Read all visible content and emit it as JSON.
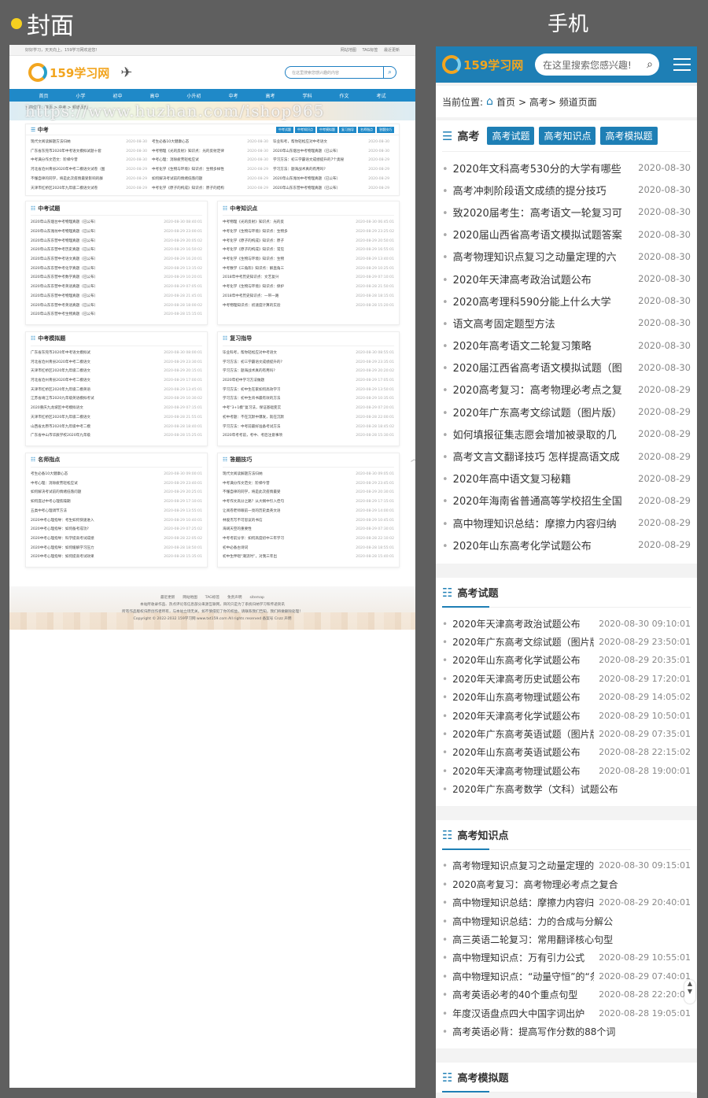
{
  "labels": {
    "cover": "封面",
    "phone": "手机"
  },
  "desktop": {
    "topbar_left": "好好学习，天天向上。159学习网欢迎您!",
    "topbar_links": [
      "网站地图",
      "TAG标签",
      "最近更新"
    ],
    "logo_text": "159学习网",
    "search_placeholder": "在这里搜索您感兴趣的内容",
    "nav": [
      "首页",
      "小学",
      "初中",
      "高中",
      "小升初",
      "中考",
      "高考",
      "学科",
      "作文",
      "考试"
    ],
    "watermark": "https://www.huzhan.com/ishop965",
    "breadcrumb": "当前位置：首页 > 中考 > 频道页面",
    "main_block": {
      "title": "中考",
      "tabs": [
        "中考试题",
        "中考知识点",
        "中考模拟题",
        "复习指导",
        "名师指点",
        "答题技巧"
      ],
      "col1": [
        {
          "t": "现代文阅读解题方法归纳",
          "d": "2020-08-30"
        },
        {
          "t": "广东省东莞市2020年中考语文模拟试题十套",
          "d": "2020-08-30"
        },
        {
          "t": "中考满分作文范文：阶梯今昔",
          "d": "2020-08-30"
        },
        {
          "t": "河北省沧州青县2020年中考二模语文试卷（图",
          "d": "2020-08-29"
        },
        {
          "t": "不懂自律的同学，将是此次疫情最受影响的群",
          "d": "2020-08-29"
        },
        {
          "t": "天津市红桥区2020年九年级二模语文试卷",
          "d": "2020-08-29"
        }
      ],
      "col2": [
        {
          "t": "考生必备10大健康心态",
          "d": "2020-08-30"
        },
        {
          "t": "中考物理《光的反射》知识点：光的反射定律",
          "d": "2020-08-30"
        },
        {
          "t": "中考心理：消除疲劳轻松应试",
          "d": "2020-08-30"
        },
        {
          "t": "中考化学《生物与环境》知识点：生物多样性",
          "d": "2020-08-29"
        },
        {
          "t": "如何解决考试前的情绪低落问题",
          "d": "2020-08-29"
        },
        {
          "t": "中考化学《原子的构成》知识点：原子的结构",
          "d": "2020-08-29"
        }
      ],
      "col3": [
        {
          "t": "毕业科考，帮你轻松应对中考语文",
          "d": "2020-08-30"
        },
        {
          "t": "2020年山东烟台中考物理真题（已公布）",
          "d": "2020-08-30"
        },
        {
          "t": "学习方法：初三学霸语文成绩提升的7个奥秘",
          "d": "2020-08-29"
        },
        {
          "t": "学习方法：题海战术真的有用吗?",
          "d": "2020-08-29"
        },
        {
          "t": "2020年山东潍坊中考物理真题（已公布）",
          "d": "2020-08-29"
        },
        {
          "t": "2020年山东东营中考物理真题（已公布）",
          "d": "2020-08-29"
        }
      ]
    },
    "cards": [
      {
        "title": "中考试题",
        "items": [
          {
            "t": "2020年山东烟台中考物理真题（已公布）",
            "d": "2020-08-30 08:40:01"
          },
          {
            "t": "2020年山东潍坊中考物理真题（已公布）",
            "d": "2020-08-29 23:00:01"
          },
          {
            "t": "2020年山东东营中考物理真题（已公布）",
            "d": "2020-08-29 20:05:02"
          },
          {
            "t": "2020年山东东营中考历史真题（已公布）",
            "d": "2020-08-29 16:50:02"
          },
          {
            "t": "2020年山东东营中考语文真题（已公布）",
            "d": "2020-08-29 16:20:01"
          },
          {
            "t": "2020年山东东营中考化学真题（已公布）",
            "d": "2020-08-29 13:15:02"
          },
          {
            "t": "2020年山东东营中考数学真题（已公布）",
            "d": "2020-08-29 10:20:01"
          },
          {
            "t": "2020年山东东营中考英语真题（已公布）",
            "d": "2020-08-29 07:05:01"
          },
          {
            "t": "2020年山东东营中考物理真题（已公布）",
            "d": "2020-08-28 21:45:01"
          },
          {
            "t": "2020年山东东营中考英语真题（已公布）",
            "d": "2020-08-28 18:00:02"
          },
          {
            "t": "2020年山东东营中考生物真题（已公布）",
            "d": "2020-08-28 15:15:01"
          }
        ]
      },
      {
        "title": "中考知识点",
        "items": [
          {
            "t": "中考物理《光的反射》知识点：光的反",
            "d": "2020-08-30 06:45:01"
          },
          {
            "t": "中考化学《生物与环境》知识点：生物多",
            "d": "2020-08-29 23:25:02"
          },
          {
            "t": "中考化学《原子的构成》知识点：原子",
            "d": "2020-08-29 20:50:01"
          },
          {
            "t": "中考化学《原子的构成》知识点：常见",
            "d": "2020-08-29 16:55:01"
          },
          {
            "t": "中考化学《生物与环境》知识点：生物",
            "d": "2020-08-29 13:40:01"
          },
          {
            "t": "中考数学《三角形》知识点：解直角三",
            "d": "2020-08-29 10:25:01"
          },
          {
            "t": "2018年中考历史知识点：文艺复兴",
            "d": "2020-08-29 07:10:01"
          },
          {
            "t": "中考化学《生物与环境》知识点：保护",
            "d": "2020-08-28 21:50:01"
          },
          {
            "t": "2018年中考历史知识点：一带一路",
            "d": "2020-08-28 18:15:01"
          },
          {
            "t": "中考物理知识点：初速度计算的实验",
            "d": "2020-08-28 15:20:01"
          }
        ]
      },
      {
        "title": "中考模拟题",
        "items": [
          {
            "t": "广东省东莞市2020年中考语文模拟试",
            "d": "2020-08-30 08:00:01"
          },
          {
            "t": "河北省沧州青县2020年中考二模语文",
            "d": "2020-08-29 23:30:01"
          },
          {
            "t": "天津市红桥区2020年九年级二模语文",
            "d": "2020-08-29 20:15:01"
          },
          {
            "t": "河北省沧州青县2020年中考二模语文",
            "d": "2020-08-29 17:00:01"
          },
          {
            "t": "天津市红桥区2020年九年级二模英语",
            "d": "2020-08-29 13:45:01"
          },
          {
            "t": "江苏省靖江市2020九年级英语模拟考试",
            "d": "2020-08-29 10:30:02"
          },
          {
            "t": "2020重庆九龙坡区中考模拟语文",
            "d": "2020-08-29 07:15:01"
          },
          {
            "t": "天津市红桥区2020年九年级二模语文",
            "d": "2020-08-28 21:55:01"
          },
          {
            "t": "山西省太原市2020年九年级中考二模",
            "d": "2020-08-28 18:40:01"
          },
          {
            "t": "广东省中山市华辰学校2020年九年级",
            "d": "2020-08-28 15:25:01"
          }
        ]
      },
      {
        "title": "复习指导",
        "items": [
          {
            "t": "毕业科考，帮你轻松应对中考语文",
            "d": "2020-08-30 08:55:01"
          },
          {
            "t": "学习方法：初三学霸语文成绩提升的?",
            "d": "2020-08-29 23:35:01"
          },
          {
            "t": "学习方法：题海战术真的有用吗?",
            "d": "2020-08-29 20:20:02"
          },
          {
            "t": "2020年初中学习方法做题",
            "d": "2020-08-29 17:05:01"
          },
          {
            "t": "学习方法：初中生在家如何高效学习",
            "d": "2020-08-29 13:50:01"
          },
          {
            "t": "学习方法：初中生背书最有效的方法",
            "d": "2020-08-29 10:35:01"
          },
          {
            "t": "中考“3+1模”复习法，保证基础变实",
            "d": "2020-08-29 07:20:01"
          },
          {
            "t": "初中考题：不在沉默中爆发，就在沉默",
            "d": "2020-08-28 22:00:01"
          },
          {
            "t": "学习方法：中考前最好准备考试方法",
            "d": "2020-08-28 18:45:02"
          },
          {
            "t": "2020年考考前，考中、考后注意事项",
            "d": "2020-08-28 15:30:01"
          }
        ]
      },
      {
        "title": "名师指点",
        "items": [
          {
            "t": "考生必备10大健康心态",
            "d": "2020-08-30 09:00:01"
          },
          {
            "t": "中考心理：消除疲劳轻松应试",
            "d": "2020-08-29 23:40:01"
          },
          {
            "t": "如何解决考试前的情绪低落问题",
            "d": "2020-08-29 20:25:01"
          },
          {
            "t": "如何度过中考心理焦躁期",
            "d": "2020-08-29 17:10:01"
          },
          {
            "t": "五类中考心理调节方法",
            "d": "2020-08-29 13:55:01"
          },
          {
            "t": "2020中考心理指导：考生如何快速进入",
            "d": "2020-08-29 10:40:01"
          },
          {
            "t": "2020中考心理指导：如何备考成功?",
            "d": "2020-08-29 07:25:02"
          },
          {
            "t": "2020中考心理指导：科学提高考试成绩",
            "d": "2020-08-28 22:05:02"
          },
          {
            "t": "2020中考心理指导：如何缓解学习压力",
            "d": "2020-08-28 18:50:01"
          },
          {
            "t": "2020中考心理指导：如何提高考试效果",
            "d": "2020-08-28 15:35:01"
          }
        ]
      },
      {
        "title": "答题技巧",
        "items": [
          {
            "t": "现代文阅读解题方法归纳",
            "d": "2020-08-30 09:05:01"
          },
          {
            "t": "中考满分作文范文：阶梯今昔",
            "d": "2020-08-29 23:45:01"
          },
          {
            "t": "不懂自律的同学，将是此次疫情最受",
            "d": "2020-08-29 20:30:01"
          },
          {
            "t": "中考作文高分之路？从大纲中引入佳句",
            "d": "2020-08-29 17:15:01"
          },
          {
            "t": "让阅卷老师眼前一亮的历史类英文语",
            "d": "2020-08-29 14:00:01"
          },
          {
            "t": "林俊杰写不可思议的书信",
            "d": "2020-08-29 10:45:01"
          },
          {
            "t": "海阔天空的重要性",
            "d": "2020-08-29 07:30:01"
          },
          {
            "t": "中考考前分享：如何高度初中三年学习",
            "d": "2020-08-28 22:10:02"
          },
          {
            "t": "初中必备古诗词",
            "d": "2020-08-28 18:55:01"
          },
          {
            "t": "初中生伴唱“潮流时”，对我三年出",
            "d": "2020-08-28 15:40:01"
          }
        ]
      }
    ],
    "footer_links": [
      "最近更新",
      "网站地图",
      "TAG标签",
      "免责声明",
      "sitemap"
    ],
    "footer_lines": [
      "本站所收录作品、热点评论等信息部分来源互联网，目的只是为了系统归纳学习和传递资讯",
      "所有作品版权归原创作者所有，与本站立场无关，如不慎侵犯了你的权益，请联系我们告知，我们将做删除处理！",
      "Copyright © 2022-2032 159学习网 www.txt159.com All rights reserved 备案号 Cnzz 声明"
    ]
  },
  "mobile": {
    "logo_text": "159学习网",
    "search_placeholder": "在这里搜索您感兴趣!",
    "breadcrumb_prefix": "当前位置:",
    "breadcrumb_home": "首页",
    "breadcrumb_rest": "> 高考> 频道页面",
    "main_title": "高考",
    "tabs": [
      "高考试题",
      "高考知识点",
      "高考模拟题"
    ],
    "main_items": [
      {
        "t": "2020年文科高考530分的大学有哪些",
        "d": "2020-08-30"
      },
      {
        "t": "高考冲刺阶段语文成绩的提分技巧",
        "d": "2020-08-30"
      },
      {
        "t": "致2020届考生：高考语文一轮复习可",
        "d": "2020-08-30"
      },
      {
        "t": "2020届山西省高考语文模拟试题答案",
        "d": "2020-08-30"
      },
      {
        "t": "高考物理知识点复习之动量定理的六",
        "d": "2020-08-30"
      },
      {
        "t": "2020年天津高考政治试题公布",
        "d": "2020-08-30"
      },
      {
        "t": "2020高考理科590分能上什么大学",
        "d": "2020-08-30"
      },
      {
        "t": "语文高考固定题型方法",
        "d": "2020-08-30"
      },
      {
        "t": "2020年高考语文二轮复习策略",
        "d": "2020-08-30"
      },
      {
        "t": "2020届江西省高考语文模拟试题（图",
        "d": "2020-08-30"
      },
      {
        "t": "2020高考复习：高考物理必考点之复",
        "d": "2020-08-29"
      },
      {
        "t": "2020年广东高考文综试题（图片版）",
        "d": "2020-08-29"
      },
      {
        "t": "如何填报征集志愿会增加被录取的几",
        "d": "2020-08-29"
      },
      {
        "t": "高考文言文翻译技巧 怎样提高语文成",
        "d": "2020-08-29"
      },
      {
        "t": "2020年高中语文复习秘籍",
        "d": "2020-08-29"
      },
      {
        "t": "2020年海南省普通高等学校招生全国",
        "d": "2020-08-29"
      },
      {
        "t": "高中物理知识总结：摩擦力内容归纳",
        "d": "2020-08-29"
      },
      {
        "t": "2020年山东高考化学试题公布",
        "d": "2020-08-29"
      }
    ],
    "sections": [
      {
        "title": "高考试题",
        "items": [
          {
            "t": "2020年天津高考政治试题公布",
            "d": "2020-08-30 09:10:01"
          },
          {
            "t": "2020年广东高考文综试题（图片版）",
            "d": "2020-08-29 23:50:01"
          },
          {
            "t": "2020年山东高考化学试题公布",
            "d": "2020-08-29 20:35:01"
          },
          {
            "t": "2020年天津高考历史试题公布",
            "d": "2020-08-29 17:20:01"
          },
          {
            "t": "2020年山东高考物理试题公布",
            "d": "2020-08-29 14:05:02"
          },
          {
            "t": "2020年天津高考化学试题公布",
            "d": "2020-08-29 10:50:01"
          },
          {
            "t": "2020年广东高考英语试题（图片版）",
            "d": "2020-08-29 07:35:01"
          },
          {
            "t": "2020年山东高考英语试题公布",
            "d": "2020-08-28 22:15:02"
          },
          {
            "t": "2020年天津高考物理试题公布",
            "d": "2020-08-28 19:00:01"
          },
          {
            "t": "2020年广东高考数学（文科）试题公布",
            "d": ""
          }
        ]
      },
      {
        "title": "高考知识点",
        "items": [
          {
            "t": "高考物理知识点复习之动量定理的六",
            "d": "2020-08-30 09:15:01"
          },
          {
            "t": "2020高考复习：高考物理必考点之复合",
            "d": ""
          },
          {
            "t": "高中物理知识总结：摩擦力内容归纳",
            "d": "2020-08-29 20:40:01"
          },
          {
            "t": "高中物理知识总结：力的合成与分解公",
            "d": ""
          },
          {
            "t": "高三英语二轮复习：常用翻译核心句型",
            "d": ""
          },
          {
            "t": "高中物理知识点：万有引力公式",
            "d": "2020-08-29 10:55:01"
          },
          {
            "t": "高中物理知识点：“动量守恒”的“条",
            "d": "2020-08-29 07:40:01"
          },
          {
            "t": "高考英语必考的40个重点句型",
            "d": "2020-08-28 22:20:01"
          },
          {
            "t": "年度汉语盘点四大中国字词出炉",
            "d": "2020-08-28 19:05:01"
          },
          {
            "t": "高考英语必背：提高写作分数的88个词",
            "d": ""
          }
        ]
      },
      {
        "title": "高考模拟题",
        "items": []
      }
    ]
  }
}
